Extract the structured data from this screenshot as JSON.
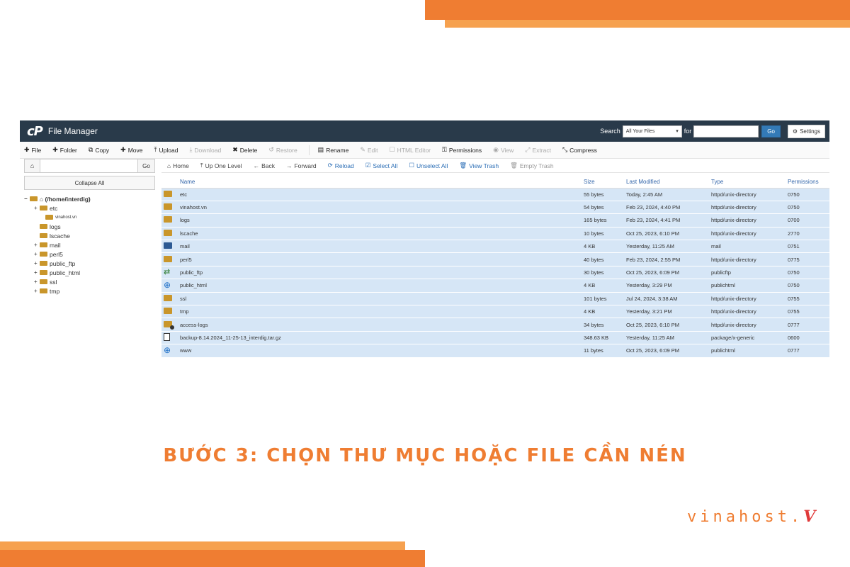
{
  "colors": {
    "accent": "#ef7d32",
    "accent_light": "#f6a14f",
    "header_bg": "#293a4a",
    "row_selected": "#d6e6f6"
  },
  "header": {
    "logo": "cP",
    "title": "File Manager",
    "search_label": "Search",
    "search_scope": "All Your Files",
    "for_label": "for",
    "search_value": "",
    "go_label": "Go",
    "settings_label": "Settings"
  },
  "toolbar": {
    "file": "File",
    "folder": "Folder",
    "copy": "Copy",
    "move": "Move",
    "upload": "Upload",
    "download": "Download",
    "delete": "Delete",
    "restore": "Restore",
    "rename": "Rename",
    "edit": "Edit",
    "html_editor": "HTML Editor",
    "permissions": "Permissions",
    "view": "View",
    "extract": "Extract",
    "compress": "Compress"
  },
  "tree": {
    "go_label": "Go",
    "collapse_label": "Collapse All",
    "root": "(/home/interdig)",
    "items": [
      "etc",
      "vinahost.vn",
      "logs",
      "lscache",
      "mail",
      "perl5",
      "public_ftp",
      "public_html",
      "ssl",
      "tmp"
    ]
  },
  "nav": {
    "home": "Home",
    "up": "Up One Level",
    "back": "Back",
    "forward": "Forward",
    "reload": "Reload",
    "select_all": "Select All",
    "unselect_all": "Unselect All",
    "view_trash": "View Trash",
    "empty_trash": "Empty Trash"
  },
  "columns": {
    "name": "Name",
    "size": "Size",
    "modified": "Last Modified",
    "type": "Type",
    "perms": "Permissions"
  },
  "files": [
    {
      "icon": "folder",
      "name": "etc",
      "size": "55 bytes",
      "modified": "Today, 2:45 AM",
      "type": "httpd/unix-directory",
      "perms": "0750"
    },
    {
      "icon": "folder",
      "name": "vinahost.vn",
      "size": "54 bytes",
      "modified": "Feb 23, 2024, 4:40 PM",
      "type": "httpd/unix-directory",
      "perms": "0750"
    },
    {
      "icon": "folder",
      "name": "logs",
      "size": "165 bytes",
      "modified": "Feb 23, 2024, 4:41 PM",
      "type": "httpd/unix-directory",
      "perms": "0700"
    },
    {
      "icon": "folder",
      "name": "lscache",
      "size": "10 bytes",
      "modified": "Oct 25, 2023, 6:10 PM",
      "type": "httpd/unix-directory",
      "perms": "2770"
    },
    {
      "icon": "mail",
      "name": "mail",
      "size": "4 KB",
      "modified": "Yesterday, 11:25 AM",
      "type": "mail",
      "perms": "0751"
    },
    {
      "icon": "folder",
      "name": "perl5",
      "size": "40 bytes",
      "modified": "Feb 23, 2024, 2:55 PM",
      "type": "httpd/unix-directory",
      "perms": "0775"
    },
    {
      "icon": "ftp",
      "name": "public_ftp",
      "size": "30 bytes",
      "modified": "Oct 25, 2023, 6:09 PM",
      "type": "publicftp",
      "perms": "0750"
    },
    {
      "icon": "globe",
      "name": "public_html",
      "size": "4 KB",
      "modified": "Yesterday, 3:29 PM",
      "type": "publichtml",
      "perms": "0750"
    },
    {
      "icon": "folder",
      "name": "ssl",
      "size": "101 bytes",
      "modified": "Jul 24, 2024, 3:38 AM",
      "type": "httpd/unix-directory",
      "perms": "0755"
    },
    {
      "icon": "folder",
      "name": "tmp",
      "size": "4 KB",
      "modified": "Yesterday, 3:21 PM",
      "type": "httpd/unix-directory",
      "perms": "0755"
    },
    {
      "icon": "folder-link",
      "name": "access-logs",
      "size": "34 bytes",
      "modified": "Oct 25, 2023, 6:10 PM",
      "type": "httpd/unix-directory",
      "perms": "0777"
    },
    {
      "icon": "doc",
      "name": "backup-8.14.2024_11-25-13_interdig.tar.gz",
      "size": "348.63 KB",
      "modified": "Yesterday, 11:25 AM",
      "type": "package/x-generic",
      "perms": "0600"
    },
    {
      "icon": "globe",
      "name": "www",
      "size": "11 bytes",
      "modified": "Oct 25, 2023, 6:09 PM",
      "type": "publichtml",
      "perms": "0777"
    }
  ],
  "caption": "BƯỚC 3: CHỌN THƯ MỤC HOẶC FILE CẦN NÉN",
  "brand": {
    "text": "vinahost.",
    "mark": "V"
  }
}
